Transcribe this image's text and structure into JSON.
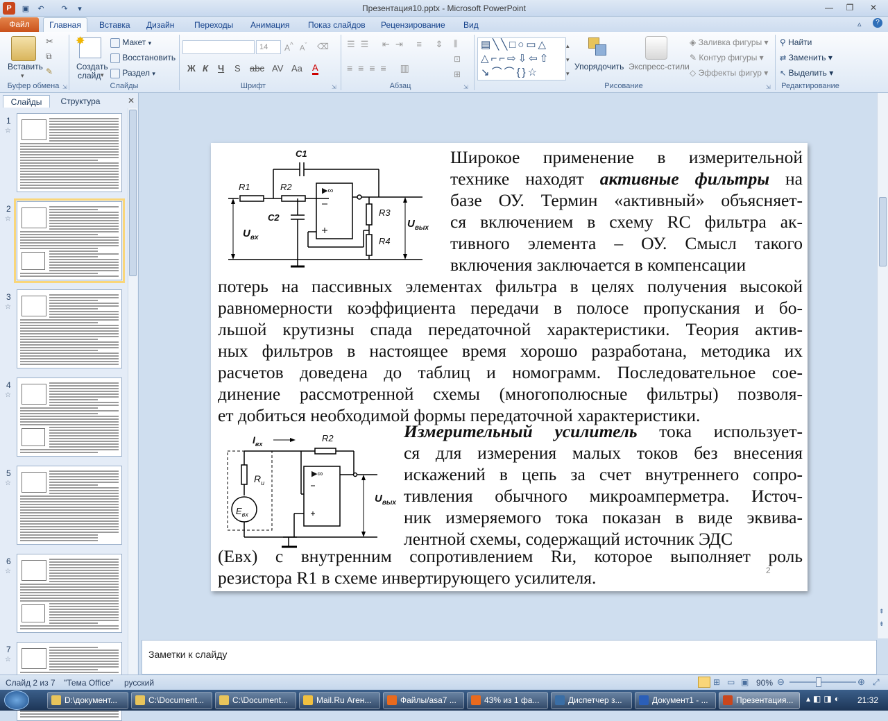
{
  "window": {
    "title": "Презентация10.pptx - Microsoft PowerPoint"
  },
  "ribbon_tabs": {
    "file": "Файл",
    "home": "Главная",
    "insert": "Вставка",
    "design": "Дизайн",
    "transitions": "Переходы",
    "animation": "Анимация",
    "slideshow": "Показ слайдов",
    "review": "Рецензирование",
    "view": "Вид"
  },
  "groups": {
    "clipboard": "Буфер обмена",
    "slides": "Слайды",
    "font": "Шрифт",
    "paragraph": "Абзац",
    "drawing": "Рисование",
    "editing": "Редактирование"
  },
  "clipboard": {
    "paste": "Вставить"
  },
  "slides_group": {
    "new_slide_l1": "Создать",
    "new_slide_l2": "слайд",
    "layout": "Макет",
    "reset": "Восстановить",
    "section": "Раздел"
  },
  "font": {
    "size": "14"
  },
  "drawing": {
    "arrange": "Упорядочить",
    "quick_styles": "Экспресс-стили",
    "fill": "Заливка фигуры",
    "outline": "Контур фигуры",
    "effects": "Эффекты фигур"
  },
  "editing": {
    "find": "Найти",
    "replace": "Заменить",
    "select": "Выделить"
  },
  "panel": {
    "tab_slides": "Слайды",
    "tab_outline": "Структура",
    "slide_numbers": [
      "1",
      "2",
      "3",
      "4",
      "5",
      "6",
      "7"
    ]
  },
  "slide": {
    "p1_lines": [
      "Широкое применение в измерительной",
      "технике находят",
      "активные фильтры",
      "на",
      "базе ОУ. Термин «активный» объясняет-",
      "ся включением в схему RC фильтра ак-",
      "тивного элемента – ОУ. Смысл такого",
      "включения заключается в компенсации"
    ],
    "p2_lines": [
      "потерь на пассивных элементах фильтра в целях получения высокой",
      "равномерности коэффициента передачи в полосе пропускания и бо-",
      "льшой крутизны спада передаточной характеристики. Теория актив-",
      "ных фильтров  в настоящее время хорошо разработана, методика их",
      "расчетов доведена до таблиц и номограмм. Последовательное сое-",
      "динение рассмотренной схемы (многополюсные фильтры) позволя-",
      "ет добиться необходимой формы передаточной характеристики."
    ],
    "p3_lines": [
      "Измерительный усилитель",
      "тока использует-",
      "ся для измерения малых токов без внесения",
      "искажений в цепь за счет внутреннего сопро-",
      "тивления обычного микроамперметра. Источ-",
      "ник измеряемого тока показан в виде эквива-",
      "лентной схемы, содержащий источник ЭДС"
    ],
    "p4_lines": [
      "(Евх) с внутренним сопротивлением Rи, которое выполняет роль",
      "резистора R1 в схеме инвертирующего усилителя."
    ],
    "page_number": "2",
    "circuit1": {
      "c1": "C1",
      "r1": "R1",
      "r2": "R2",
      "c2": "C2",
      "r3": "R3",
      "r4": "R4",
      "uin": "U",
      "uin_sub": "вх",
      "uout": "U",
      "uout_sub": "вых",
      "opamp": "▶∞"
    },
    "circuit2": {
      "iin": "I",
      "iin_sub": "вх",
      "r2": "R2",
      "ri": "R",
      "ri_sub": "и",
      "ein": "E",
      "ein_sub": "вх",
      "uout": "U",
      "uout_sub": "вых",
      "opamp": "▶∞"
    }
  },
  "notes": {
    "placeholder": "Заметки к слайду"
  },
  "status": {
    "slide_of": "Слайд 2 из 7",
    "theme": "\"Тема Office\"",
    "language": "русский",
    "zoom": "90%"
  },
  "taskbar": {
    "items": [
      "D:\\документ...",
      "C:\\Document...",
      "C:\\Document...",
      "Mail.Ru Аген...",
      "Файлы/asa7 ...",
      "43% из 1 фа...",
      "Диспетчер з...",
      "Документ1 - ...",
      "Презентация..."
    ],
    "time": "21:32"
  }
}
